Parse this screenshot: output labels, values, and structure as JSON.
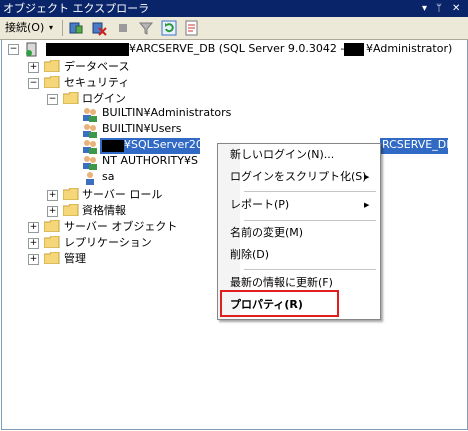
{
  "window": {
    "title": "オブジェクト エクスプローラ",
    "pin_glyph": "▾ ⊥ ×"
  },
  "toolbar": {
    "connect_label": "接続(O)",
    "dropdown_glyph": "▾"
  },
  "tree": {
    "server_label": "¥ARCSERVE_DB (SQL Server 9.0.3042 - ",
    "server_user": "¥Administrator)",
    "databases": "データベース",
    "security": "セキュリティ",
    "logins": "ログイン",
    "login_items": [
      "BUILTIN¥Administrators",
      "BUILTIN¥Users",
      "¥SQLServer20",
      "NT AUTHORITY¥S",
      "sa"
    ],
    "selected_tail": "RCSERVE_DB",
    "server_roles": "サーバー ロール",
    "credentials": "資格情報",
    "server_objects": "サーバー オブジェクト",
    "replication": "レプリケーション",
    "management": "管理"
  },
  "context_menu": {
    "items": [
      "新しいログイン(N)...",
      "ログインをスクリプト化(S)",
      "レポート(P)",
      "名前の変更(M)",
      "削除(D)",
      "最新の情報に更新(F)",
      "プロパティ(R)"
    ],
    "submenu_glyph": "▶"
  }
}
